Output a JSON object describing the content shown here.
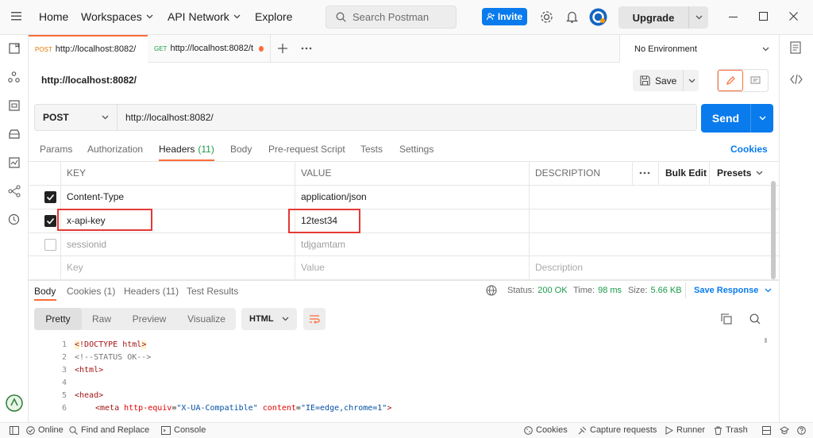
{
  "titlebar": {
    "nav": [
      "Home",
      "Workspaces",
      "API Network",
      "Explore"
    ],
    "search_placeholder": "Search Postman",
    "invite_label": "Invite",
    "upgrade_label": "Upgrade"
  },
  "tabs": [
    {
      "method": "POST",
      "label": "http://localhost:8082/"
    },
    {
      "method": "GET",
      "label": "http://localhost:8082/t"
    }
  ],
  "environment": "No Environment",
  "request": {
    "name": "http://localhost:8082/",
    "save_label": "Save",
    "method": "POST",
    "url": "http://localhost:8082/",
    "send_label": "Send"
  },
  "request_tabs": [
    "Params",
    "Authorization",
    "Headers",
    "Body",
    "Pre-request Script",
    "Tests",
    "Settings"
  ],
  "headers_count": "(11)",
  "cookies_link": "Cookies",
  "headers_table": {
    "columns": [
      "KEY",
      "VALUE",
      "DESCRIPTION"
    ],
    "bulk_edit": "Bulk Edit",
    "presets": "Presets",
    "rows": [
      {
        "key": "Content-Type",
        "value": "application/json",
        "checked": true
      },
      {
        "key": "x-api-key",
        "value": "12test34",
        "checked": true
      },
      {
        "key": "sessionid",
        "value": "tdjgamtam",
        "checked": false
      }
    ],
    "placeholders": {
      "key": "Key",
      "value": "Value",
      "description": "Description"
    }
  },
  "response": {
    "tabs": [
      "Body",
      "Cookies (1)",
      "Headers (11)",
      "Test Results"
    ],
    "status_label": "Status:",
    "status_value": "200 OK",
    "time_label": "Time:",
    "time_value": "98 ms",
    "size_label": "Size:",
    "size_value": "5.66 KB",
    "save_response": "Save Response",
    "view_modes": [
      "Pretty",
      "Raw",
      "Preview",
      "Visualize"
    ],
    "format": "HTML",
    "code_lines": [
      "1",
      "2",
      "3",
      "4",
      "5",
      "6"
    ]
  },
  "statusbar": {
    "left": [
      "Online",
      "Find and Replace",
      "Console"
    ],
    "right": [
      "Cookies",
      "Capture requests",
      "Runner",
      "Trash"
    ]
  },
  "colors": {
    "accent": "#ff6c37",
    "brand_blue": "#097bed",
    "highlight_red": "#e53935"
  }
}
